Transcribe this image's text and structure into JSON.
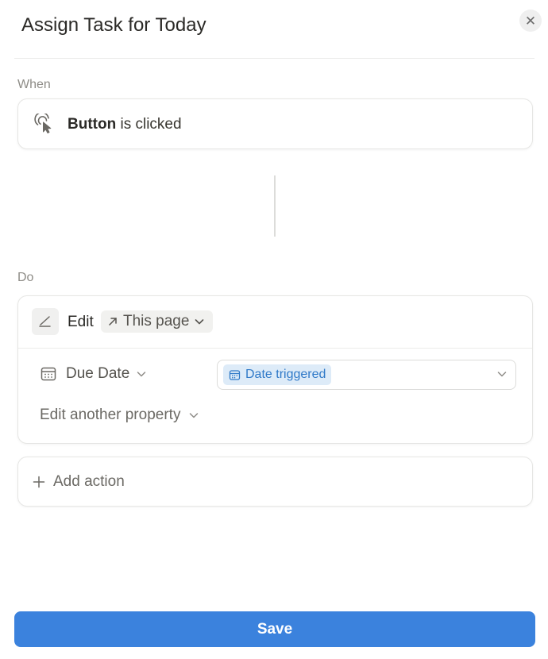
{
  "dialog": {
    "title": "Assign Task for Today",
    "close_icon": "close-icon"
  },
  "when": {
    "label": "When",
    "trigger_icon": "pointer-click-icon",
    "trigger_subject": "Button",
    "trigger_rest": "is clicked"
  },
  "do": {
    "label": "Do",
    "action": {
      "icon": "edit-pencil-icon",
      "verb": "Edit",
      "target_icon": "arrow-up-right-icon",
      "target": "This page",
      "property": {
        "icon": "calendar-icon",
        "name": "Due Date",
        "value_icon": "calendar-icon",
        "value": "Date triggered"
      },
      "edit_another": "Edit another property"
    },
    "add_action": "Add action"
  },
  "footer": {
    "save_label": "Save"
  },
  "colors": {
    "accent": "#3b82dd",
    "chip_bg": "#ddebf8",
    "chip_text": "#2f79c8"
  }
}
